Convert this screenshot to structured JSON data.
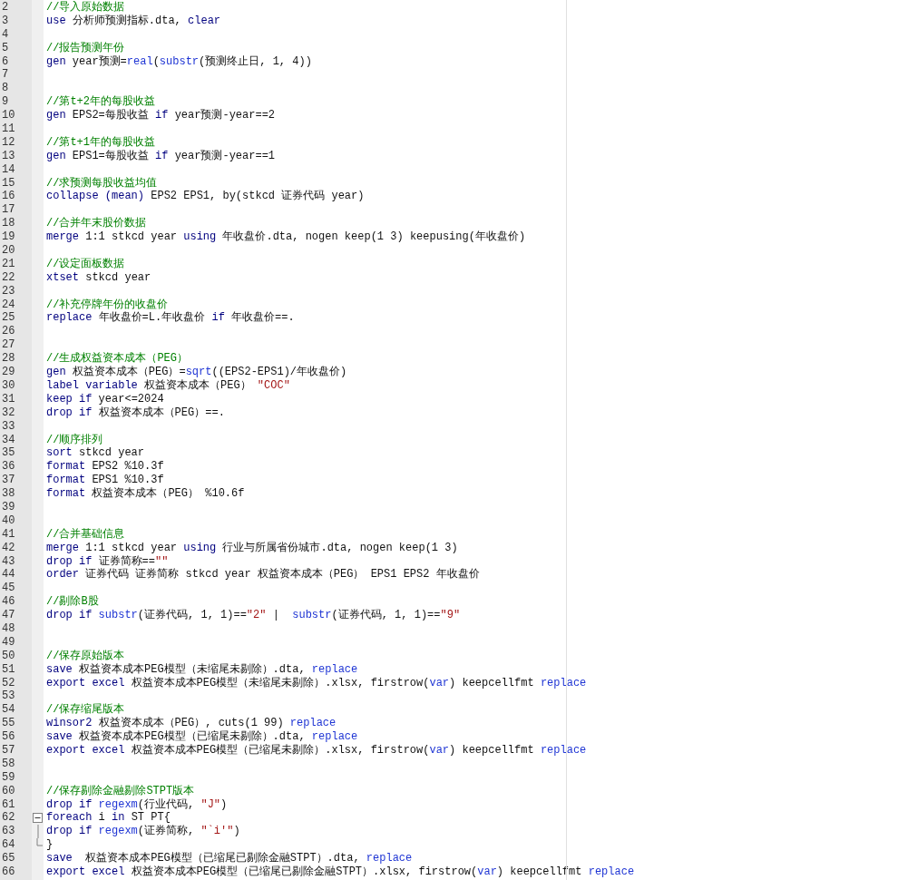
{
  "editor": {
    "lines": [
      {
        "number": "2",
        "kind": "line",
        "tokens": [
          {
            "kind": "comment",
            "text": "//导入原始数据"
          }
        ]
      },
      {
        "number": "3",
        "kind": "line",
        "tokens": [
          {
            "kind": "keyword",
            "text": "use"
          },
          {
            "kind": "plain",
            "text": " 分析师预测指标.dta, "
          },
          {
            "kind": "keyword",
            "text": "clear"
          }
        ]
      },
      {
        "number": "4",
        "kind": "line"
      },
      {
        "number": "5",
        "kind": "line",
        "tokens": [
          {
            "kind": "comment",
            "text": "//报告预测年份"
          }
        ]
      },
      {
        "number": "6",
        "kind": "line",
        "tokens": [
          {
            "kind": "keyword",
            "text": "gen"
          },
          {
            "kind": "plain",
            "text": " year预测="
          },
          {
            "kind": "function",
            "text": "real"
          },
          {
            "kind": "plain",
            "text": "("
          },
          {
            "kind": "function",
            "text": "substr"
          },
          {
            "kind": "plain",
            "text": "(预测终止日, 1, 4))"
          }
        ]
      },
      {
        "number": "7",
        "kind": "line"
      },
      {
        "number": "8",
        "kind": "line"
      },
      {
        "number": "9",
        "kind": "line",
        "tokens": [
          {
            "kind": "comment",
            "text": "//第t+2年的每股收益"
          }
        ]
      },
      {
        "number": "10",
        "kind": "line",
        "tokens": [
          {
            "kind": "keyword",
            "text": "gen"
          },
          {
            "kind": "plain",
            "text": " EPS2=每股收益 "
          },
          {
            "kind": "keyword",
            "text": "if"
          },
          {
            "kind": "plain",
            "text": " year预测-year==2"
          }
        ]
      },
      {
        "number": "11",
        "kind": "line"
      },
      {
        "number": "12",
        "kind": "line",
        "tokens": [
          {
            "kind": "comment",
            "text": "//第t+1年的每股收益"
          }
        ]
      },
      {
        "number": "13",
        "kind": "line",
        "tokens": [
          {
            "kind": "keyword",
            "text": "gen"
          },
          {
            "kind": "plain",
            "text": " EPS1=每股收益 "
          },
          {
            "kind": "keyword",
            "text": "if"
          },
          {
            "kind": "plain",
            "text": " year预测-year==1"
          }
        ]
      },
      {
        "number": "14",
        "kind": "line"
      },
      {
        "number": "15",
        "kind": "line",
        "tokens": [
          {
            "kind": "comment",
            "text": "//求预测每股收益均值"
          }
        ]
      },
      {
        "number": "16",
        "kind": "line",
        "tokens": [
          {
            "kind": "keyword",
            "text": "collapse (mean)"
          },
          {
            "kind": "plain",
            "text": " EPS2 EPS1, by(stkcd 证券代码 year)"
          }
        ]
      },
      {
        "number": "17",
        "kind": "line"
      },
      {
        "number": "18",
        "kind": "line",
        "tokens": [
          {
            "kind": "comment",
            "text": "//合并年末股价数据"
          }
        ]
      },
      {
        "number": "19",
        "kind": "line",
        "tokens": [
          {
            "kind": "keyword",
            "text": "merge"
          },
          {
            "kind": "plain",
            "text": " 1:1 stkcd year "
          },
          {
            "kind": "keyword",
            "text": "using"
          },
          {
            "kind": "plain",
            "text": " 年收盘价.dta, nogen keep(1 3) keepusing(年收盘价)"
          }
        ]
      },
      {
        "number": "20",
        "kind": "line"
      },
      {
        "number": "21",
        "kind": "line",
        "tokens": [
          {
            "kind": "comment",
            "text": "//设定面板数据"
          }
        ]
      },
      {
        "number": "22",
        "kind": "line",
        "tokens": [
          {
            "kind": "keyword",
            "text": "xtset"
          },
          {
            "kind": "plain",
            "text": " stkcd year"
          }
        ]
      },
      {
        "number": "23",
        "kind": "line"
      },
      {
        "number": "24",
        "kind": "line",
        "tokens": [
          {
            "kind": "comment",
            "text": "//补充停牌年份的收盘价"
          }
        ]
      },
      {
        "number": "25",
        "kind": "line",
        "tokens": [
          {
            "kind": "keyword",
            "text": "replace"
          },
          {
            "kind": "plain",
            "text": " 年收盘价=L.年收盘价 "
          },
          {
            "kind": "keyword",
            "text": "if"
          },
          {
            "kind": "plain",
            "text": " 年收盘价==."
          }
        ]
      },
      {
        "number": "26",
        "kind": "line"
      },
      {
        "number": "27",
        "kind": "line"
      },
      {
        "number": "28",
        "kind": "line",
        "tokens": [
          {
            "kind": "comment",
            "text": "//生成权益资本成本（PEG）"
          }
        ]
      },
      {
        "number": "29",
        "kind": "line",
        "tokens": [
          {
            "kind": "keyword",
            "text": "gen"
          },
          {
            "kind": "plain",
            "text": " 权益资本成本（PEG）="
          },
          {
            "kind": "function",
            "text": "sqrt"
          },
          {
            "kind": "plain",
            "text": "((EPS2-EPS1)/年收盘价)"
          }
        ]
      },
      {
        "number": "30",
        "kind": "line",
        "tokens": [
          {
            "kind": "keyword",
            "text": "label variable"
          },
          {
            "kind": "plain",
            "text": " 权益资本成本（PEG） "
          },
          {
            "kind": "string",
            "text": "\"COC\""
          }
        ]
      },
      {
        "number": "31",
        "kind": "line",
        "tokens": [
          {
            "kind": "keyword",
            "text": "keep if"
          },
          {
            "kind": "plain",
            "text": " year<=2024"
          }
        ]
      },
      {
        "number": "32",
        "kind": "line",
        "tokens": [
          {
            "kind": "keyword",
            "text": "drop if"
          },
          {
            "kind": "plain",
            "text": " 权益资本成本（PEG）==."
          }
        ]
      },
      {
        "number": "33",
        "kind": "line"
      },
      {
        "number": "34",
        "kind": "line",
        "tokens": [
          {
            "kind": "comment",
            "text": "//顺序排列"
          }
        ]
      },
      {
        "number": "35",
        "kind": "line",
        "tokens": [
          {
            "kind": "keyword",
            "text": "sort"
          },
          {
            "kind": "plain",
            "text": " stkcd year"
          }
        ]
      },
      {
        "number": "36",
        "kind": "line",
        "tokens": [
          {
            "kind": "keyword",
            "text": "format"
          },
          {
            "kind": "plain",
            "text": " EPS2 %10.3f"
          }
        ]
      },
      {
        "number": "37",
        "kind": "line",
        "tokens": [
          {
            "kind": "keyword",
            "text": "format"
          },
          {
            "kind": "plain",
            "text": " EPS1 %10.3f"
          }
        ]
      },
      {
        "number": "38",
        "kind": "line",
        "tokens": [
          {
            "kind": "keyword",
            "text": "format"
          },
          {
            "kind": "plain",
            "text": " 权益资本成本（PEG） %10.6f"
          }
        ]
      },
      {
        "number": "39",
        "kind": "line"
      },
      {
        "number": "40",
        "kind": "line"
      },
      {
        "number": "41",
        "kind": "line",
        "tokens": [
          {
            "kind": "comment",
            "text": "//合并基础信息"
          }
        ]
      },
      {
        "number": "42",
        "kind": "line",
        "tokens": [
          {
            "kind": "keyword",
            "text": "merge"
          },
          {
            "kind": "plain",
            "text": " 1:1 stkcd year "
          },
          {
            "kind": "keyword",
            "text": "using"
          },
          {
            "kind": "plain",
            "text": " 行业与所属省份城市.dta, nogen keep(1 3)"
          }
        ]
      },
      {
        "number": "43",
        "kind": "line",
        "tokens": [
          {
            "kind": "keyword",
            "text": "drop if"
          },
          {
            "kind": "plain",
            "text": " 证券简称=="
          },
          {
            "kind": "string",
            "text": "\"\""
          }
        ]
      },
      {
        "number": "44",
        "kind": "line",
        "tokens": [
          {
            "kind": "keyword",
            "text": "order"
          },
          {
            "kind": "plain",
            "text": " 证券代码 证券简称 stkcd year 权益资本成本（PEG） EPS1 EPS2 年收盘价"
          }
        ]
      },
      {
        "number": "45",
        "kind": "line"
      },
      {
        "number": "46",
        "kind": "line",
        "tokens": [
          {
            "kind": "comment",
            "text": "//剔除B股"
          }
        ]
      },
      {
        "number": "47",
        "kind": "line",
        "tokens": [
          {
            "kind": "keyword",
            "text": "drop if "
          },
          {
            "kind": "function",
            "text": "substr"
          },
          {
            "kind": "plain",
            "text": "(证券代码, 1, 1)=="
          },
          {
            "kind": "string",
            "text": "\"2\""
          },
          {
            "kind": "plain",
            "text": " |  "
          },
          {
            "kind": "function",
            "text": "substr"
          },
          {
            "kind": "plain",
            "text": "(证券代码, 1, 1)=="
          },
          {
            "kind": "string",
            "text": "\"9\""
          }
        ]
      },
      {
        "number": "48",
        "kind": "line"
      },
      {
        "number": "49",
        "kind": "line"
      },
      {
        "number": "50",
        "kind": "line",
        "tokens": [
          {
            "kind": "comment",
            "text": "//保存原始版本"
          }
        ]
      },
      {
        "number": "51",
        "kind": "line",
        "tokens": [
          {
            "kind": "keyword",
            "text": "save"
          },
          {
            "kind": "plain",
            "text": " 权益资本成本PEG模型（未缩尾未剔除）.dta, "
          },
          {
            "kind": "function",
            "text": "replace"
          }
        ]
      },
      {
        "number": "52",
        "kind": "line",
        "tokens": [
          {
            "kind": "keyword",
            "text": "export excel"
          },
          {
            "kind": "plain",
            "text": " 权益资本成本PEG模型（未缩尾未剔除）.xlsx, firstrow("
          },
          {
            "kind": "function",
            "text": "var"
          },
          {
            "kind": "plain",
            "text": ") keepcellfmt "
          },
          {
            "kind": "function",
            "text": "replace"
          }
        ]
      },
      {
        "number": "53",
        "kind": "line"
      },
      {
        "number": "54",
        "kind": "line",
        "tokens": [
          {
            "kind": "comment",
            "text": "//保存缩尾版本"
          }
        ]
      },
      {
        "number": "55",
        "kind": "line",
        "tokens": [
          {
            "kind": "keyword",
            "text": "winsor2"
          },
          {
            "kind": "plain",
            "text": " 权益资本成本（PEG）, cuts(1 99) "
          },
          {
            "kind": "function",
            "text": "replace"
          }
        ]
      },
      {
        "number": "56",
        "kind": "line",
        "tokens": [
          {
            "kind": "keyword",
            "text": "save"
          },
          {
            "kind": "plain",
            "text": " 权益资本成本PEG模型（已缩尾未剔除）.dta, "
          },
          {
            "kind": "function",
            "text": "replace"
          }
        ]
      },
      {
        "number": "57",
        "kind": "line",
        "tokens": [
          {
            "kind": "keyword",
            "text": "export excel"
          },
          {
            "kind": "plain",
            "text": " 权益资本成本PEG模型（已缩尾未剔除）.xlsx, firstrow("
          },
          {
            "kind": "function",
            "text": "var"
          },
          {
            "kind": "plain",
            "text": ") keepcellfmt "
          },
          {
            "kind": "function",
            "text": "replace"
          }
        ]
      },
      {
        "number": "58",
        "kind": "line"
      },
      {
        "number": "59",
        "kind": "line"
      },
      {
        "number": "60",
        "kind": "line",
        "tokens": [
          {
            "kind": "comment",
            "text": "//保存剔除金融剔除STPT版本"
          }
        ]
      },
      {
        "number": "61",
        "kind": "line",
        "tokens": [
          {
            "kind": "keyword",
            "text": "drop if "
          },
          {
            "kind": "function",
            "text": "regexm"
          },
          {
            "kind": "plain",
            "text": "(行业代码, "
          },
          {
            "kind": "string",
            "text": "\"J\""
          },
          {
            "kind": "plain",
            "text": ")"
          }
        ]
      },
      {
        "number": "62",
        "kind": "block_start",
        "tokens": [
          {
            "kind": "keyword",
            "text": "foreach"
          },
          {
            "kind": "plain",
            "text": " i "
          },
          {
            "kind": "keyword",
            "text": "in"
          },
          {
            "kind": "plain",
            "text": " ST PT{"
          }
        ]
      },
      {
        "number": "63",
        "kind": "block_body",
        "tokens": [
          {
            "kind": "keyword",
            "text": "drop if "
          },
          {
            "kind": "function",
            "text": "regexm"
          },
          {
            "kind": "plain",
            "text": "(证券简称, "
          },
          {
            "kind": "string",
            "text": "\"`i'\""
          },
          {
            "kind": "plain",
            "text": ")"
          }
        ]
      },
      {
        "number": "64",
        "kind": "block_end",
        "tokens": [
          {
            "kind": "plain",
            "text": "}"
          }
        ]
      },
      {
        "number": "65",
        "kind": "line",
        "tokens": [
          {
            "kind": "keyword",
            "text": "save"
          },
          {
            "kind": "plain",
            "text": "  权益资本成本PEG模型（已缩尾已剔除金融STPT）.dta, "
          },
          {
            "kind": "function",
            "text": "replace"
          }
        ]
      },
      {
        "number": "66",
        "kind": "line",
        "tokens": [
          {
            "kind": "keyword",
            "text": "export excel"
          },
          {
            "kind": "plain",
            "text": " 权益资本成本PEG模型（已缩尾已剔除金融STPT）.xlsx, firstrow("
          },
          {
            "kind": "function",
            "text": "var"
          },
          {
            "kind": "plain",
            "text": ") keepcellfmt "
          },
          {
            "kind": "function",
            "text": "replace"
          }
        ]
      }
    ]
  }
}
